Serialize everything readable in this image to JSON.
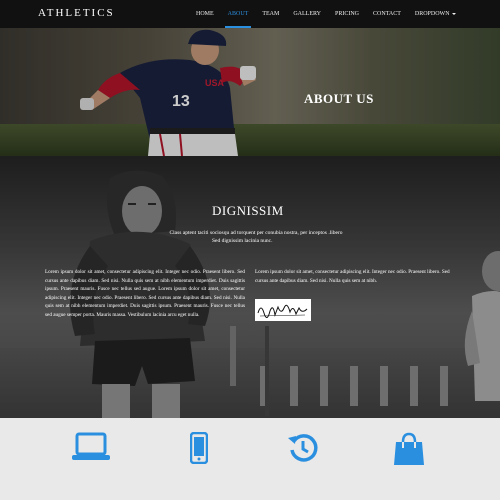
{
  "navbar": {
    "brand": "ATHLETICS",
    "items": [
      {
        "label": "HOME",
        "active": false
      },
      {
        "label": "ABOUT",
        "active": true
      },
      {
        "label": "TEAM",
        "active": false
      },
      {
        "label": "GALLERY",
        "active": false
      },
      {
        "label": "PRICING",
        "active": false
      },
      {
        "label": "CONTACT",
        "active": false
      },
      {
        "label": "DROPDOWN",
        "active": false,
        "has_caret": true
      }
    ],
    "active_color": "#2b8fe0"
  },
  "hero": {
    "title": "ABOUT US",
    "player_number": "13"
  },
  "section": {
    "title": "DIGNISSIM",
    "subtitle_line1": "Class aptent taciti sociosqu ad torquent per conubia nostra, per inceptos .libero",
    "subtitle_line2": "Sed dignissim lacinia nunc.",
    "column1": "Lorem ipsum dolor sit amet, consectetur adipiscing elit. Integer nec odio. Praesent libero. Sed cursus ante dapibus diam. Sed nisi. Nulla quis sem at nibh elementum imperdiet. Duis sagittis ipsum. Praesent mauris. Fusce nec tellus sed augue. Lorem ipsum dolor sit amet, consectetur adipiscing elit. Integer nec odio. Praesent libero. Sed cursus ante dapibus diam. Sed nisi. Nulla quis sem at nibh elementum imperdiet. Duis sagittis ipsum. Praesent mauris. Fusce nec tellus sed augue semper porta. Mauris massa. Vestibulum lacinia arcu eget nulla.",
    "column2": "Lorem ipsum dolor sit amet, consectetur adipiscing elit. Integer nec odio. Praesent libero. Sed cursus ante dapibus diam. Sed nisi. Nulla quis sem at nibh."
  },
  "features": {
    "accent": "#2b8fe0",
    "icons": [
      "laptop-icon",
      "phone-icon",
      "history-icon",
      "shopping-bag-icon"
    ]
  }
}
